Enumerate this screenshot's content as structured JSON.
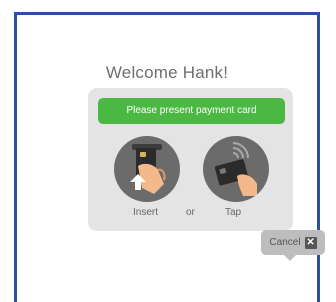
{
  "welcome_text": "Welcome Hank!",
  "prompt_banner": "Please present payment card",
  "options": {
    "insert_label": "Insert",
    "separator": "or",
    "tap_label": "Tap"
  },
  "cancel": {
    "label": "Cancel",
    "icon": "close-icon"
  },
  "colors": {
    "frame_border": "#2f4e9c",
    "banner_green": "#4cb844",
    "panel_gray": "#e4e4e4",
    "circle_gray": "#6b6b6b"
  }
}
